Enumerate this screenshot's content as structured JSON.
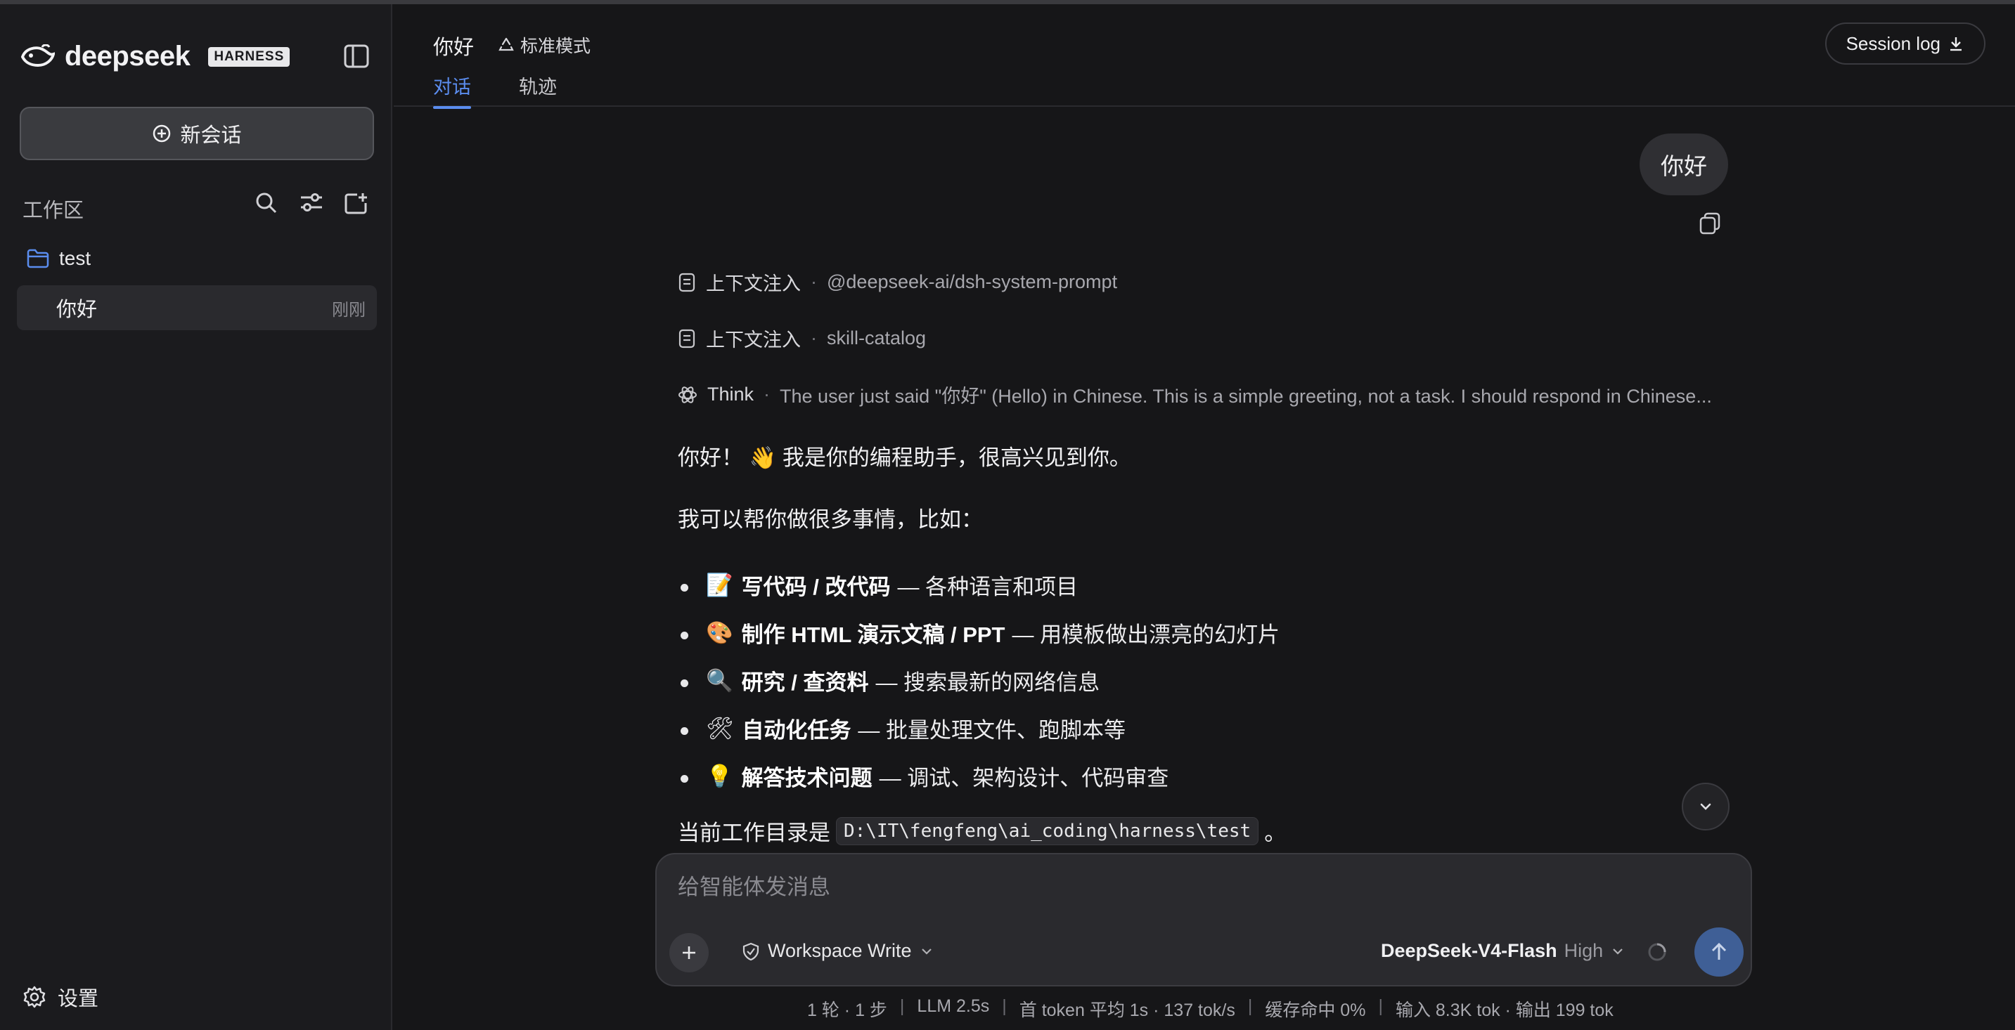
{
  "sidebar": {
    "logo_text": "deepseek",
    "logo_badge": "HARNESS",
    "new_chat_label": "新会话",
    "workspace_label": "工作区",
    "folder_name": "test",
    "session": {
      "title": "你好",
      "time": "刚刚"
    },
    "settings_label": "设置"
  },
  "header": {
    "title": "你好",
    "mode_label": "标准模式",
    "tabs": [
      {
        "label": "对话"
      },
      {
        "label": "轨迹"
      }
    ],
    "session_log_label": "Session log"
  },
  "conversation": {
    "user_message": "你好",
    "traces": [
      {
        "label": "上下文注入",
        "detail": "@deepseek-ai/dsh-system-prompt"
      },
      {
        "label": "上下文注入",
        "detail": "skill-catalog"
      },
      {
        "label": "Think",
        "detail": "The user just said \"你好\" (Hello) in Chinese. This is a simple greeting, not a task. I should respond in Chinese..."
      }
    ],
    "greeting": "你好！ 👋 我是你的编程助手，很高兴见到你。",
    "intro": "我可以帮你做很多事情，比如：",
    "bullets": [
      {
        "emoji": "📝",
        "bold": "写代码 / 改代码",
        "rest": "— 各种语言和项目"
      },
      {
        "emoji": "🎨",
        "bold": "制作 HTML 演示文稿 / PPT",
        "rest": "— 用模板做出漂亮的幻灯片"
      },
      {
        "emoji": "🔍",
        "bold": "研究 / 查资料",
        "rest": "— 搜索最新的网络信息"
      },
      {
        "emoji": "🛠",
        "bold": "自动化任务",
        "rest": "— 批量处理文件、跑脚本等"
      },
      {
        "emoji": "💡",
        "bold": "解答技术问题",
        "rest": "— 调试、架构设计、代码审查"
      }
    ],
    "cwd_prefix": "当前工作目录是",
    "cwd_path": "D:\\IT\\fengfeng\\ai_coding\\harness\\test",
    "cwd_suffix": "。"
  },
  "composer": {
    "placeholder": "给智能体发消息",
    "permission_label": "Workspace Write",
    "model_name": "DeepSeek-V4-Flash",
    "model_level": "High"
  },
  "stats": [
    "1 轮 · 1 步",
    "LLM 2.5s",
    "首 token 平均 1s · 137 tok/s",
    "缓存命中 0%",
    "输入 8.3K tok · 输出 199 tok"
  ],
  "colors": {
    "accent": "#5b8def",
    "background": "#161618",
    "sidebar": "#1b1b1e",
    "send_button": "#3f5f96"
  }
}
